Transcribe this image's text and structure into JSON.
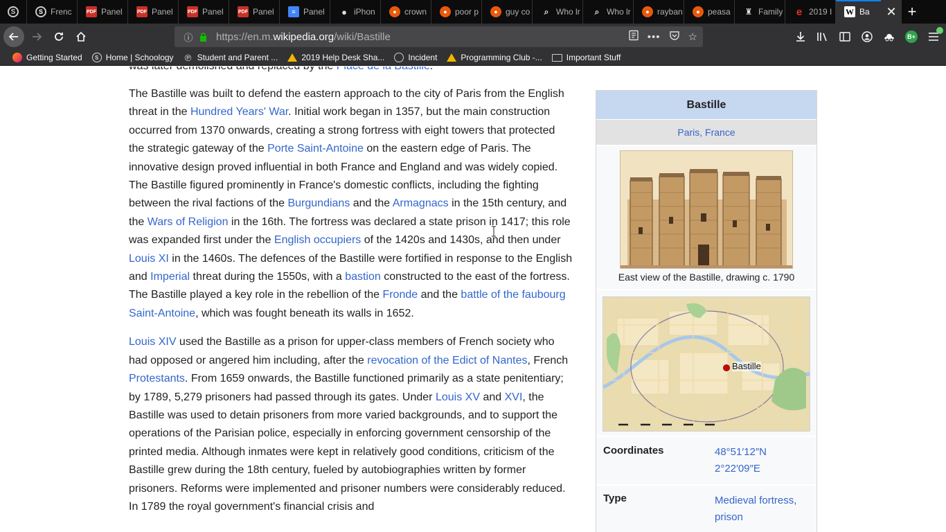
{
  "tabs": [
    {
      "title": "Frenc",
      "icon": "schoology-icon"
    },
    {
      "title": "Panel",
      "icon": "pdf-icon"
    },
    {
      "title": "Panel",
      "icon": "pdf-icon"
    },
    {
      "title": "Panel",
      "icon": "pdf-icon"
    },
    {
      "title": "Panel",
      "icon": "pdf-icon"
    },
    {
      "title": "Panel",
      "icon": "docs-icon"
    },
    {
      "title": "iPhon",
      "icon": "apple-icon"
    },
    {
      "title": "crown",
      "icon": "reddit-icon"
    },
    {
      "title": "poor p",
      "icon": "reddit-icon"
    },
    {
      "title": "guy co",
      "icon": "reddit-icon"
    },
    {
      "title": "Who lr",
      "icon": "search-icon"
    },
    {
      "title": "Who lr",
      "icon": "search-icon"
    },
    {
      "title": "rayban",
      "icon": "reddit-icon"
    },
    {
      "title": "peasa",
      "icon": "reddit-icon"
    },
    {
      "title": "Family",
      "icon": "crest-icon"
    },
    {
      "title": "2019 I",
      "icon": "e-icon"
    },
    {
      "title": "Ba",
      "icon": "wikipedia-icon",
      "active": true
    }
  ],
  "navbar": {
    "url_prefix": "https://en.m.",
    "url_domain": "wikipedia.org",
    "url_path": "/wiki/Bastille"
  },
  "bookmarks": [
    {
      "label": "Getting Started",
      "icon": "firefox-icon"
    },
    {
      "label": "Home | Schoology",
      "icon": "schoology-icon"
    },
    {
      "label": "Student and Parent ...",
      "icon": "p-icon"
    },
    {
      "label": "2019 Help Desk Sha...",
      "icon": "drive-icon"
    },
    {
      "label": "Incident",
      "icon": "globe-icon"
    },
    {
      "label": "Programming Club -...",
      "icon": "drive-icon"
    },
    {
      "label": "Important Stuff",
      "icon": "folder-icon"
    }
  ],
  "article": {
    "cut_line_before": "was later demolished and replaced by the ",
    "cut_line_link": "Place de la Bastille",
    "cut_line_after": ".",
    "p1": [
      {
        "t": "The Bastille was built to defend the eastern approach to the city of Paris from the English threat in the "
      },
      {
        "t": "Hundred Years' War",
        "link": true
      },
      {
        "t": ". Initial work began in 1357, but the main construction occurred from 1370 onwards, creating a strong fortress with eight towers that protected the strategic gateway of the "
      },
      {
        "t": "Porte Saint-Antoine",
        "link": true
      },
      {
        "t": " on the eastern edge of Paris. The innovative design proved influential in both France and England and was widely copied. The Bastille figured prominently in France's domestic conflicts, including the fighting between the rival factions of the "
      },
      {
        "t": "Burgundians",
        "link": true
      },
      {
        "t": " and the "
      },
      {
        "t": "Armagnacs",
        "link": true
      },
      {
        "t": " in the 15th century, and the "
      },
      {
        "t": "Wars of Religion",
        "link": true
      },
      {
        "t": " in the 16th. The fortress was declared a state prison in 1417; this role was expanded first under the "
      },
      {
        "t": "English occupiers",
        "link": true
      },
      {
        "t": " of the 1420s and 1430s, and then under "
      },
      {
        "t": "Louis XI",
        "link": true
      },
      {
        "t": " in the 1460s. The defences of the Bastille were fortified in response to the English and "
      },
      {
        "t": "Imperial",
        "link": true
      },
      {
        "t": " threat during the 1550s, with a "
      },
      {
        "t": "bastion",
        "link": true
      },
      {
        "t": " constructed to the east of the fortress. The Bastille played a key role in the rebellion of the "
      },
      {
        "t": "Fronde",
        "link": true
      },
      {
        "t": " and the "
      },
      {
        "t": "battle of the faubourg Saint-Antoine",
        "link": true
      },
      {
        "t": ", which was fought beneath its walls in 1652."
      }
    ],
    "p2": [
      {
        "t": "Louis XIV",
        "link": true
      },
      {
        "t": " used the Bastille as a prison for upper-class members of French society who had opposed or angered him including, after the "
      },
      {
        "t": "revocation of the Edict of Nantes",
        "link": true
      },
      {
        "t": ", French "
      },
      {
        "t": "Protestants",
        "link": true
      },
      {
        "t": ". From 1659 onwards, the Bastille functioned primarily as a state penitentiary; by 1789, 5,279 prisoners had passed through its gates. Under "
      },
      {
        "t": "Louis XV",
        "link": true
      },
      {
        "t": " and "
      },
      {
        "t": "XVI",
        "link": true
      },
      {
        "t": ", the Bastille was used to detain prisoners from more varied backgrounds, and to support the operations of the Parisian police, especially in enforcing government censorship of the printed media. Although inmates were kept in relatively good conditions, criticism of the Bastille grew during the 18th century, fueled by autobiographies written by former prisoners. Reforms were implemented and prisoner numbers were considerably reduced. In 1789 the royal government's financial crisis and"
      }
    ]
  },
  "infobox": {
    "title": "Bastille",
    "subtitle": "Paris, France",
    "image_caption": "East view of the Bastille, drawing c. 1790",
    "map_label": "Bastille",
    "rows": [
      {
        "key": "Coordinates",
        "value_lines": [
          "48°51′12″N",
          "2°22′09″E"
        ]
      },
      {
        "key": "Type",
        "value_lines": [
          "Medieval fortress,",
          "prison"
        ]
      }
    ]
  }
}
